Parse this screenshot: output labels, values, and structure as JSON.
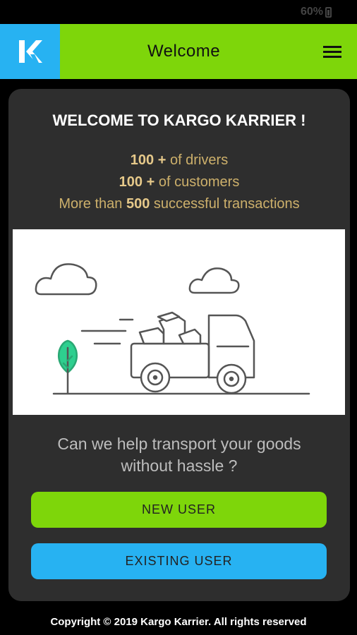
{
  "status": {
    "battery": "60%"
  },
  "appbar": {
    "title": "Welcome",
    "menu_icon": "hamburger-menu-icon",
    "logo_icon": "kargo-logo-icon"
  },
  "card": {
    "heading": "WELCOME TO KARGO KARRIER !",
    "drivers_count": "100 +",
    "drivers_text": " of drivers",
    "customers_count": "100 +",
    "customers_text": " of customers",
    "tx_prefix": "More than ",
    "tx_count": "500",
    "tx_text": " successful transactions",
    "question_line1": "Can we help transport your goods",
    "question_line2": "without hassle ?",
    "new_user_label": "NEW USER",
    "existing_user_label": "EXISTING USER"
  },
  "footer": {
    "text": "Copyright © 2019 Kargo Karrier. All rights reserved"
  },
  "colors": {
    "green": "#7ed60a",
    "blue": "#27b2f2",
    "card": "#2e2e2e",
    "gold": "#cdb06b"
  }
}
